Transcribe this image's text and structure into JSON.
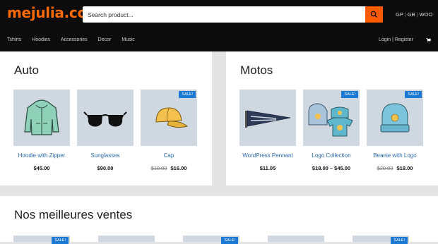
{
  "header": {
    "logo": "mejulia.com",
    "search_placeholder": "Search product...",
    "languages": [
      "GP",
      "GB",
      "WOO"
    ],
    "nav": [
      "Tshirts",
      "Hoodies",
      "Accessories",
      "Decor",
      "Music"
    ],
    "auth": "Login | Register"
  },
  "sections": [
    {
      "title": "Auto",
      "products": [
        {
          "name": "Hoodie with Zipper",
          "price": "$45.00",
          "old_price": "",
          "sale": ""
        },
        {
          "name": "Sunglasses",
          "price": "$90.00",
          "old_price": "",
          "sale": ""
        },
        {
          "name": "Cap",
          "price": "$16.00",
          "old_price": "$18.00",
          "sale": "SALE!"
        }
      ]
    },
    {
      "title": "Motos",
      "products": [
        {
          "name": "WordPress Pennant",
          "price": "$11.05",
          "old_price": "",
          "sale": ""
        },
        {
          "name": "Logo Collection",
          "price": "$18.00 – $45.00",
          "old_price": "",
          "sale": "SALE!"
        },
        {
          "name": "Beanie with Logo",
          "price": "$18.00",
          "old_price": "$20.00",
          "sale": "SALE!"
        }
      ]
    }
  ],
  "bestsellers": {
    "title": "Nos meilleures ventes",
    "sale_labels": [
      "SALE!",
      "SALE!",
      "SALE!"
    ]
  },
  "colors": {
    "accent": "#ff6a00",
    "link": "#2b6bb3",
    "sale_badge": "#1b79d4"
  }
}
